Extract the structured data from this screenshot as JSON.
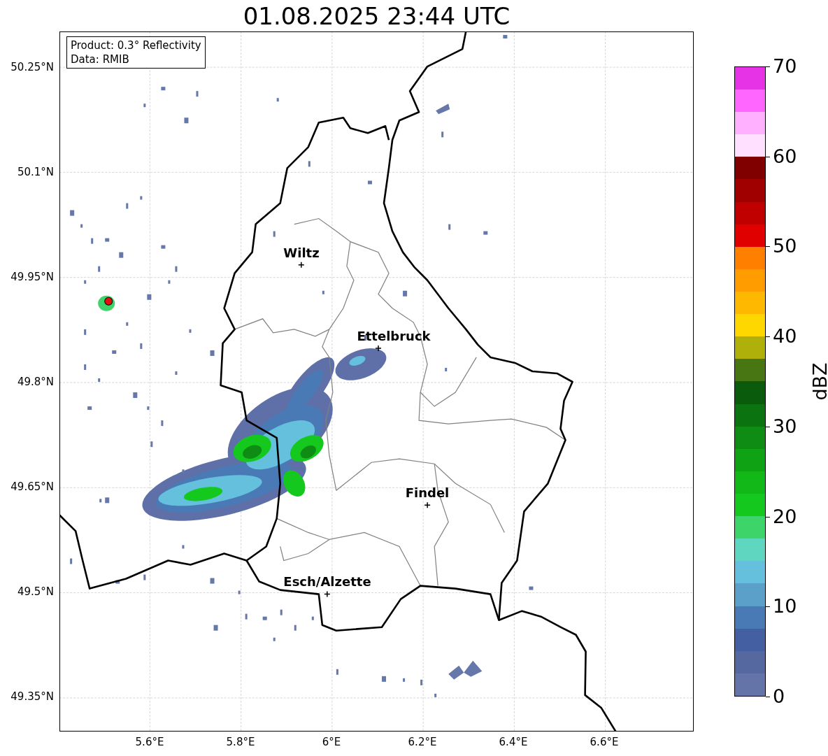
{
  "title": "01.08.2025 23:44 UTC",
  "info_box": {
    "lines": [
      "Product: 0.3° Reflectivity",
      "Data: RMIB"
    ]
  },
  "map": {
    "lat_ticks": [
      "50.25°N",
      "50.1°N",
      "49.95°N",
      "49.8°N",
      "49.65°N",
      "49.5°N",
      "49.35°N"
    ],
    "lon_ticks": [
      "5.6°E",
      "5.8°E",
      "6°E",
      "6.2°E",
      "6.4°E",
      "6.6°E"
    ],
    "cities": [
      {
        "name": "Wiltz"
      },
      {
        "name": "Ettelbruck"
      },
      {
        "name": "Findel"
      },
      {
        "name": "Esch/Alzette"
      }
    ]
  },
  "colorbar": {
    "label": "dBZ",
    "ticks": [
      "70",
      "60",
      "50",
      "40",
      "30",
      "20",
      "10",
      "0"
    ],
    "bands": [
      {
        "color": "#6474a8"
      },
      {
        "color": "#55689f"
      },
      {
        "color": "#4460a3"
      },
      {
        "color": "#4a7ab5"
      },
      {
        "color": "#5aa0c8"
      },
      {
        "color": "#64c0dc"
      },
      {
        "color": "#5fd6c0"
      },
      {
        "color": "#3dd56a"
      },
      {
        "color": "#14c81e"
      },
      {
        "color": "#12b818"
      },
      {
        "color": "#10a215"
      },
      {
        "color": "#0f8c14"
      },
      {
        "color": "#0b7410"
      },
      {
        "color": "#0a5c0c"
      },
      {
        "color": "#477613"
      },
      {
        "color": "#b0b00a"
      },
      {
        "color": "#ffd700"
      },
      {
        "color": "#ffb800"
      },
      {
        "color": "#ff9c00"
      },
      {
        "color": "#ff7f00"
      },
      {
        "color": "#e00000"
      },
      {
        "color": "#c00000"
      },
      {
        "color": "#a00000"
      },
      {
        "color": "#800000"
      },
      {
        "color": "#ffe0ff"
      },
      {
        "color": "#ffb0ff"
      },
      {
        "color": "#ff66ff"
      },
      {
        "color": "#e633e6"
      }
    ]
  }
}
